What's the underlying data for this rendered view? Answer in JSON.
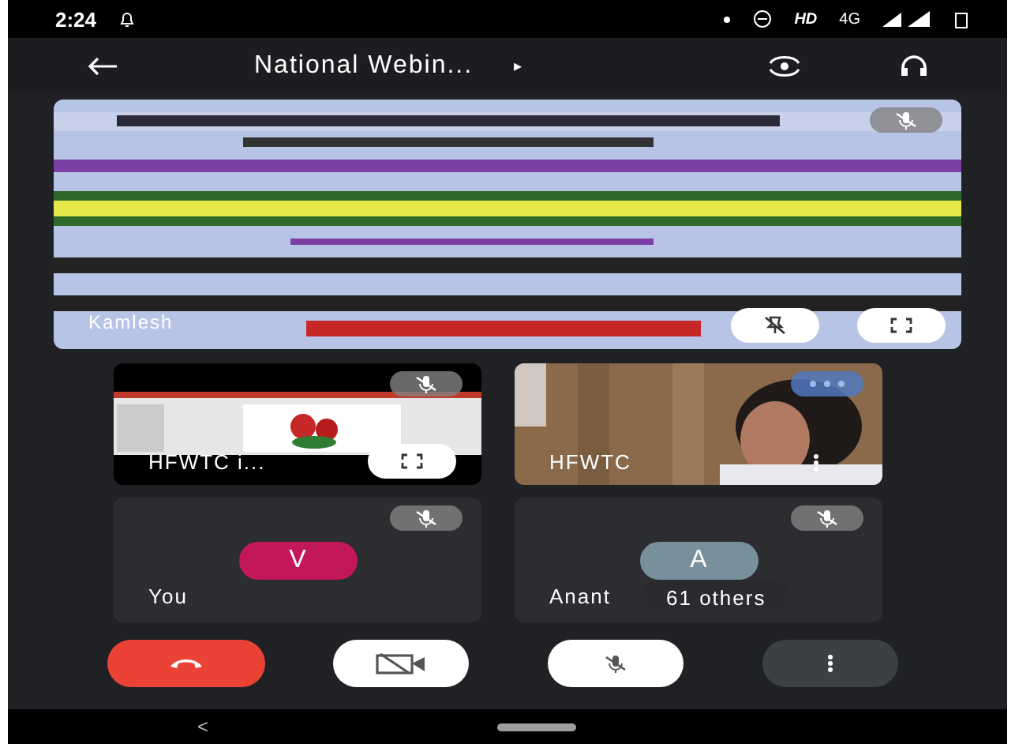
{
  "status_bar": {
    "time": "2:24",
    "network": "HD",
    "signal_type": "4G"
  },
  "header": {
    "title": "National Webin...",
    "title_arrow": "▸"
  },
  "main_tile": {
    "name": "Kamlesh",
    "muted": true
  },
  "tiles": [
    {
      "kind": "share",
      "name": "HFWTC i...",
      "muted": true
    },
    {
      "kind": "video",
      "name": "HFWTC",
      "muted": false
    },
    {
      "kind": "avatar",
      "name": "You",
      "initial": "V",
      "color": "#c2185b",
      "muted": true
    },
    {
      "kind": "avatar",
      "name": "Anant",
      "initial": "A",
      "color": "#78909c",
      "muted": true,
      "others": "61 others"
    }
  ],
  "controls": [
    {
      "kind": "hangup"
    },
    {
      "kind": "camera",
      "on": false
    },
    {
      "kind": "mic",
      "on": false
    },
    {
      "kind": "more"
    }
  ],
  "nav": {
    "back": "<"
  }
}
